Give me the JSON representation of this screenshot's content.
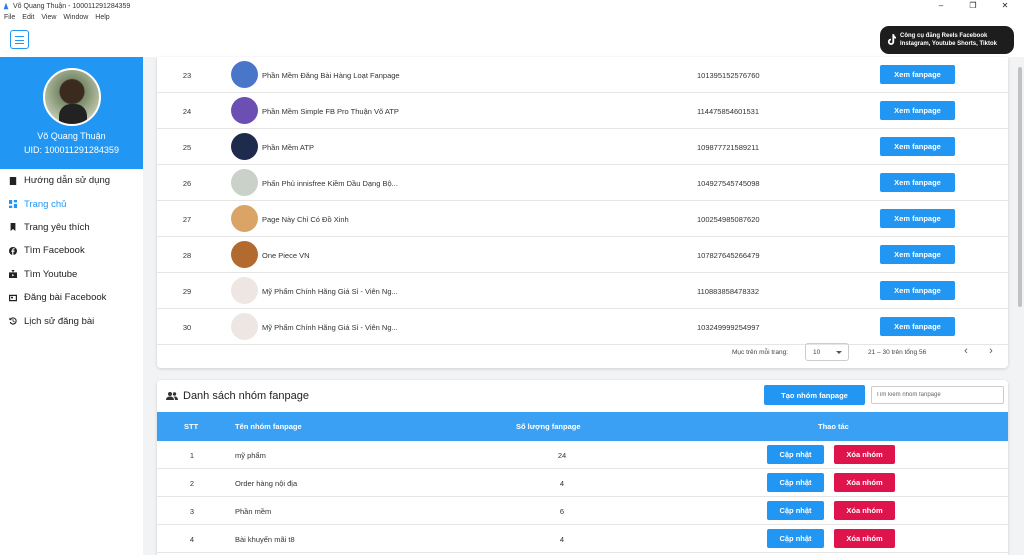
{
  "window": {
    "title": "Võ Quang Thuận - 100011291284359",
    "minimize": "–",
    "restore": "❐",
    "close": "✕"
  },
  "menu": [
    "File",
    "Edit",
    "View",
    "Window",
    "Help"
  ],
  "promo": {
    "line1": "Công cụ đăng Reels Facebook",
    "line2": "Instagram, Youtube Shorts, Tiktok"
  },
  "profile": {
    "name": "Võ Quang Thuận",
    "uid": "UID: 100011291284359"
  },
  "nav": [
    {
      "label": "Hướng dẫn sử dụng",
      "icon": "book-icon",
      "active": false
    },
    {
      "label": "Trang chủ",
      "icon": "dashboard-icon",
      "active": true
    },
    {
      "label": "Trang yêu thích",
      "icon": "bookmark-icon",
      "active": false
    },
    {
      "label": "Tìm Facebook",
      "icon": "facebook-icon",
      "active": false
    },
    {
      "label": "Tìm Youtube",
      "icon": "youtube-icon",
      "active": false
    },
    {
      "label": "Đăng bài Facebook",
      "icon": "post-icon",
      "active": false
    },
    {
      "label": "Lịch sử đăng bài",
      "icon": "history-icon",
      "active": false
    }
  ],
  "pages": {
    "view_label": "Xem fanpage",
    "rows": [
      {
        "stt": "23",
        "name": "Phần Mềm Đăng Bài Hàng Loạt Fanpage",
        "id": "101395152576760",
        "logo": "#4a76c9"
      },
      {
        "stt": "24",
        "name": "Phần Mềm Simple FB Pro Thuận Võ ATP",
        "id": "114475854601531",
        "logo": "#6b4fb3"
      },
      {
        "stt": "25",
        "name": "Phần Mềm ATP",
        "id": "109877721589211",
        "logo": "#1f2b4d"
      },
      {
        "stt": "26",
        "name": "Phấn Phủ innisfree Kiềm Dầu Dạng Bộ...",
        "id": "104927545745098",
        "logo": "#c9d1c9"
      },
      {
        "stt": "27",
        "name": "Page Này Chỉ Có Đồ Xinh",
        "id": "100254985087620",
        "logo": "#d9a466"
      },
      {
        "stt": "28",
        "name": "One Piece VN",
        "id": "107827645266479",
        "logo": "#b36a2e"
      },
      {
        "stt": "29",
        "name": "Mỹ Phẩm Chính Hãng Giá Sỉ - Viên Ng...",
        "id": "110883858478332",
        "logo": "#eee6e2"
      },
      {
        "stt": "30",
        "name": "Mỹ Phẩm Chính Hãng Giá Sỉ - Viên Ng...",
        "id": "103249999254997",
        "logo": "#eee6e2"
      }
    ],
    "pager": {
      "per_page_label": "Mục trên mỗi trang:",
      "per_page_value": "10",
      "range": "21 – 30 trên tổng 56",
      "prev": "‹",
      "next": "›"
    }
  },
  "groups": {
    "title": "Danh sách nhóm fanpage",
    "create_label": "Tạo nhóm fanpage",
    "search_placeholder": "Tìm kiếm nhóm fanpage",
    "columns": [
      "STT",
      "Tên nhóm fanpage",
      "Số lượng fanpage",
      "Thao tác"
    ],
    "update_label": "Cập nhật",
    "delete_label": "Xóa nhóm",
    "rows": [
      {
        "stt": "1",
        "name": "mỹ phẩm",
        "count": "24"
      },
      {
        "stt": "2",
        "name": "Order hàng nội địa",
        "count": "4"
      },
      {
        "stt": "3",
        "name": "Phần mềm",
        "count": "6"
      },
      {
        "stt": "4",
        "name": "Bài khuyến mãi t8",
        "count": "4"
      }
    ]
  }
}
